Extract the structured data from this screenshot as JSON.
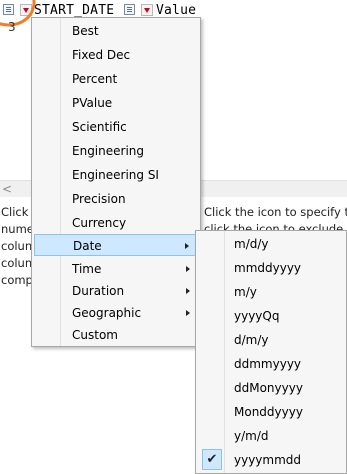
{
  "header": {
    "column_name": "START_DATE",
    "value_label": "Value",
    "row_stub": "3"
  },
  "description": {
    "left_lines": [
      "Click",
      "nume",
      "colun",
      "colun",
      "comp"
    ],
    "right_lines": [
      "Click the icon to specify t",
      "click the icon to exclude"
    ]
  },
  "scrollbar": {
    "left_arrow": "<"
  },
  "format_menu": {
    "items": [
      {
        "label": "Best",
        "submenu": false
      },
      {
        "label": "Fixed Dec",
        "submenu": false
      },
      {
        "label": "Percent",
        "submenu": false
      },
      {
        "label": "PValue",
        "submenu": false
      },
      {
        "label": "Scientific",
        "submenu": false
      },
      {
        "label": "Engineering",
        "submenu": false
      },
      {
        "label": "Engineering SI",
        "submenu": false
      },
      {
        "label": "Precision",
        "submenu": false
      },
      {
        "label": "Currency",
        "submenu": false
      },
      {
        "label": "Date",
        "submenu": true
      },
      {
        "label": "Time",
        "submenu": true
      },
      {
        "label": "Duration",
        "submenu": true
      },
      {
        "label": "Geographic",
        "submenu": true
      },
      {
        "label": "Custom",
        "submenu": false
      }
    ],
    "active_item": "Date"
  },
  "date_submenu": {
    "items": [
      "m/d/y",
      "mmddyyyy",
      "m/y",
      "yyyyQq",
      "d/m/y",
      "ddmmyyyy",
      "ddMonyyyy",
      "Monddyyyy",
      "y/m/d",
      "yyyymmdd"
    ],
    "checked_item": "yyyymmdd",
    "check_glyph": "✔"
  },
  "colors": {
    "highlight": "#cde8ff",
    "annotation_circle": "#f07d2a",
    "dropdown_arrow": "#d0021b"
  }
}
